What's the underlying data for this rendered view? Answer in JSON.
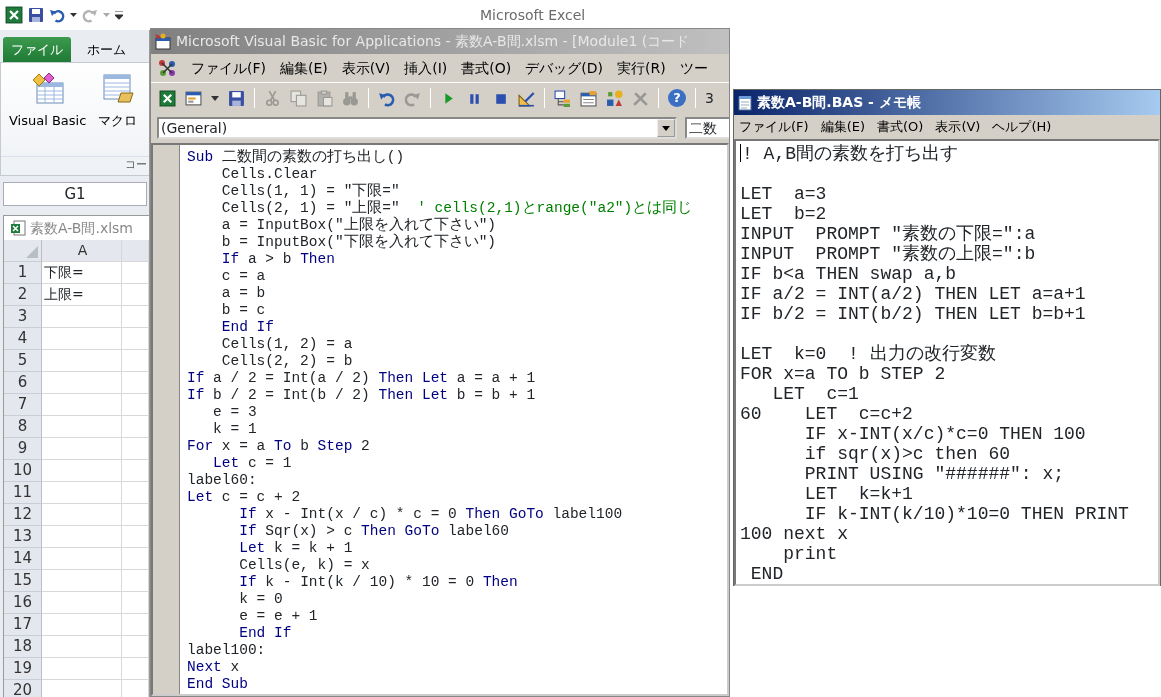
{
  "excel": {
    "title": "Microsoft Excel",
    "quick_access": [
      {
        "kind": "save",
        "disabled": false
      },
      {
        "kind": "undo",
        "disabled": false
      },
      {
        "kind": "redo",
        "disabled": true
      }
    ],
    "ribbon_tabs": [
      {
        "kind": "file",
        "label": "ファイル"
      },
      {
        "kind": "tab",
        "label": "ホーム"
      }
    ],
    "ribbon_buttons": [
      {
        "kind": "visual-basic",
        "label": "Visual Basic"
      },
      {
        "kind": "macro",
        "label": "マクロ"
      }
    ],
    "ribbon_group_label": "コー",
    "name_box": "G1",
    "workbook": {
      "title": "素数A-B間.xlsm",
      "columns": [
        "A"
      ],
      "rows": [
        {
          "number": "1",
          "cells": [
            "下限="
          ]
        },
        {
          "number": "2",
          "cells": [
            "上限="
          ]
        },
        {
          "number": "3"
        },
        {
          "number": "4"
        },
        {
          "number": "5"
        },
        {
          "number": "6"
        },
        {
          "number": "7"
        },
        {
          "number": "8"
        },
        {
          "number": "9"
        },
        {
          "number": "10"
        },
        {
          "number": "11"
        },
        {
          "number": "12"
        },
        {
          "number": "13"
        },
        {
          "number": "14"
        },
        {
          "number": "15"
        },
        {
          "number": "16"
        },
        {
          "number": "17"
        },
        {
          "number": "18"
        },
        {
          "number": "19"
        },
        {
          "number": "20"
        }
      ]
    }
  },
  "vba": {
    "title": "Microsoft Visual Basic for Applications - 素数A-B間.xlsm - [Module1 (コード",
    "menu": [
      "ファイル(F)",
      "編集(E)",
      "表示(V)",
      "挿入(I)",
      "書式(O)",
      "デバッグ(D)",
      "実行(R)",
      "ツー"
    ],
    "toolbar": [
      {
        "kind": "excel",
        "disabled": false
      },
      {
        "kind": "userform",
        "disabled": false
      },
      {
        "kind": "save",
        "disabled": false
      },
      {
        "kind": "separator"
      },
      {
        "kind": "cut",
        "disabled": true
      },
      {
        "kind": "copy",
        "disabled": true
      },
      {
        "kind": "paste",
        "disabled": true
      },
      {
        "kind": "find",
        "disabled": true
      },
      {
        "kind": "separator"
      },
      {
        "kind": "undo",
        "disabled": false
      },
      {
        "kind": "redo",
        "disabled": true
      },
      {
        "kind": "separator"
      },
      {
        "kind": "run",
        "disabled": false
      },
      {
        "kind": "break",
        "disabled": false
      },
      {
        "kind": "reset",
        "disabled": false
      },
      {
        "kind": "design",
        "disabled": false
      },
      {
        "kind": "separator"
      },
      {
        "kind": "explorer",
        "disabled": false
      },
      {
        "kind": "properties",
        "disabled": false
      },
      {
        "kind": "browser",
        "disabled": false
      },
      {
        "kind": "toolbox",
        "disabled": true
      },
      {
        "kind": "separator"
      },
      {
        "kind": "help",
        "label": "?",
        "disabled": false
      },
      {
        "kind": "separator"
      }
    ],
    "toolbar_text": "3",
    "object_combo": "(General)",
    "procedure_combo": "二数",
    "code_lines": [
      [
        {
          "kind": "keyword",
          "text": "Sub"
        },
        {
          "kind": "text",
          "text": " 二数間の素数の打ち出し()"
        }
      ],
      [
        {
          "kind": "text",
          "text": "    Cells.Clear"
        }
      ],
      [
        {
          "kind": "text",
          "text": "    Cells(1, 1) = \"下限=\""
        }
      ],
      [
        {
          "kind": "text",
          "text": "    Cells(2, 1) = \"上限=\"  "
        },
        {
          "kind": "comment",
          "text": "' cells(2,1)とrange(\"a2\")とは同じ"
        }
      ],
      [
        {
          "kind": "text",
          "text": "    a = InputBox(\"上限を入れて下さい\")"
        }
      ],
      [
        {
          "kind": "text",
          "text": "    b = InputBox(\"下限を入れて下さい\")"
        }
      ],
      [
        {
          "kind": "keyword",
          "text": "    If"
        },
        {
          "kind": "text",
          "text": " a > b "
        },
        {
          "kind": "keyword",
          "text": "Then"
        }
      ],
      [
        {
          "kind": "text",
          "text": "    c = a"
        }
      ],
      [
        {
          "kind": "text",
          "text": "    a = b"
        }
      ],
      [
        {
          "kind": "text",
          "text": "    b = c"
        }
      ],
      [
        {
          "kind": "keyword",
          "text": "    End If"
        }
      ],
      [
        {
          "kind": "text",
          "text": "    Cells(1, 2) = a"
        }
      ],
      [
        {
          "kind": "text",
          "text": "    Cells(2, 2) = b"
        }
      ],
      [
        {
          "kind": "keyword",
          "text": "If"
        },
        {
          "kind": "text",
          "text": " a / 2 = Int(a / 2) "
        },
        {
          "kind": "keyword",
          "text": "Then Let"
        },
        {
          "kind": "text",
          "text": " a = a + 1"
        }
      ],
      [
        {
          "kind": "keyword",
          "text": "If"
        },
        {
          "kind": "text",
          "text": " b / 2 = Int(b / 2) "
        },
        {
          "kind": "keyword",
          "text": "Then Let"
        },
        {
          "kind": "text",
          "text": " b = b + 1"
        }
      ],
      [
        {
          "kind": "text",
          "text": "   e = 3"
        }
      ],
      [
        {
          "kind": "text",
          "text": "   k = 1"
        }
      ],
      [
        {
          "kind": "keyword",
          "text": "For"
        },
        {
          "kind": "text",
          "text": " x = a "
        },
        {
          "kind": "keyword",
          "text": "To"
        },
        {
          "kind": "text",
          "text": " b "
        },
        {
          "kind": "keyword",
          "text": "Step"
        },
        {
          "kind": "text",
          "text": " 2"
        }
      ],
      [
        {
          "kind": "keyword",
          "text": "   Let"
        },
        {
          "kind": "text",
          "text": " c = 1"
        }
      ],
      [
        {
          "kind": "text",
          "text": "label60:"
        }
      ],
      [
        {
          "kind": "keyword",
          "text": "Let"
        },
        {
          "kind": "text",
          "text": " c = c + 2"
        }
      ],
      [
        {
          "kind": "keyword",
          "text": "      If"
        },
        {
          "kind": "text",
          "text": " x - Int(x / c) * c = 0 "
        },
        {
          "kind": "keyword",
          "text": "Then GoTo"
        },
        {
          "kind": "text",
          "text": " label100"
        }
      ],
      [
        {
          "kind": "keyword",
          "text": "      If"
        },
        {
          "kind": "text",
          "text": " Sqr(x) > c "
        },
        {
          "kind": "keyword",
          "text": "Then GoTo"
        },
        {
          "kind": "text",
          "text": " label60"
        }
      ],
      [
        {
          "kind": "keyword",
          "text": "      Let"
        },
        {
          "kind": "text",
          "text": " k = k + 1"
        }
      ],
      [
        {
          "kind": "text",
          "text": "      Cells(e, k) = x"
        }
      ],
      [
        {
          "kind": "keyword",
          "text": "      If"
        },
        {
          "kind": "text",
          "text": " k - Int(k / 10) * 10 = 0 "
        },
        {
          "kind": "keyword",
          "text": "Then"
        }
      ],
      [
        {
          "kind": "text",
          "text": "      k = 0"
        }
      ],
      [
        {
          "kind": "text",
          "text": "      e = e + 1"
        }
      ],
      [
        {
          "kind": "keyword",
          "text": "      End If"
        }
      ],
      [
        {
          "kind": "text",
          "text": "label100:"
        }
      ],
      [
        {
          "kind": "keyword",
          "text": "Next"
        },
        {
          "kind": "text",
          "text": " x"
        }
      ],
      [
        {
          "kind": "keyword",
          "text": "End Sub"
        }
      ]
    ]
  },
  "notepad": {
    "title": "素数A-B間.BAS - メモ帳",
    "menu": [
      "ファイル(F)",
      "編集(E)",
      "書式(O)",
      "表示(V)",
      "ヘルプ(H)"
    ],
    "blocks": [
      [
        "! A,B間の素数を打ち出す"
      ],
      [
        "LET  a=3",
        "LET  b=2",
        "INPUT  PROMPT \"素数の下限=\":a",
        "INPUT  PROMPT \"素数の上限=\":b",
        "IF b<a THEN swap a,b",
        "IF a/2 = INT(a/2) THEN LET a=a+1",
        "IF b/2 = INT(b/2) THEN LET b=b+1"
      ],
      [
        "LET  k=0  ! 出力の改行変数",
        "FOR x=a TO b STEP 2",
        "   LET  c=1",
        "60    LET  c=c+2",
        "      IF x-INT(x/c)*c=0 THEN 100",
        "      if sqr(x)>c then 60",
        "      PRINT USING \"######\": x;",
        "      LET  k=k+1",
        "      IF k-INT(k/10)*10=0 THEN PRINT",
        "100 next x",
        "    print",
        " END"
      ]
    ]
  }
}
